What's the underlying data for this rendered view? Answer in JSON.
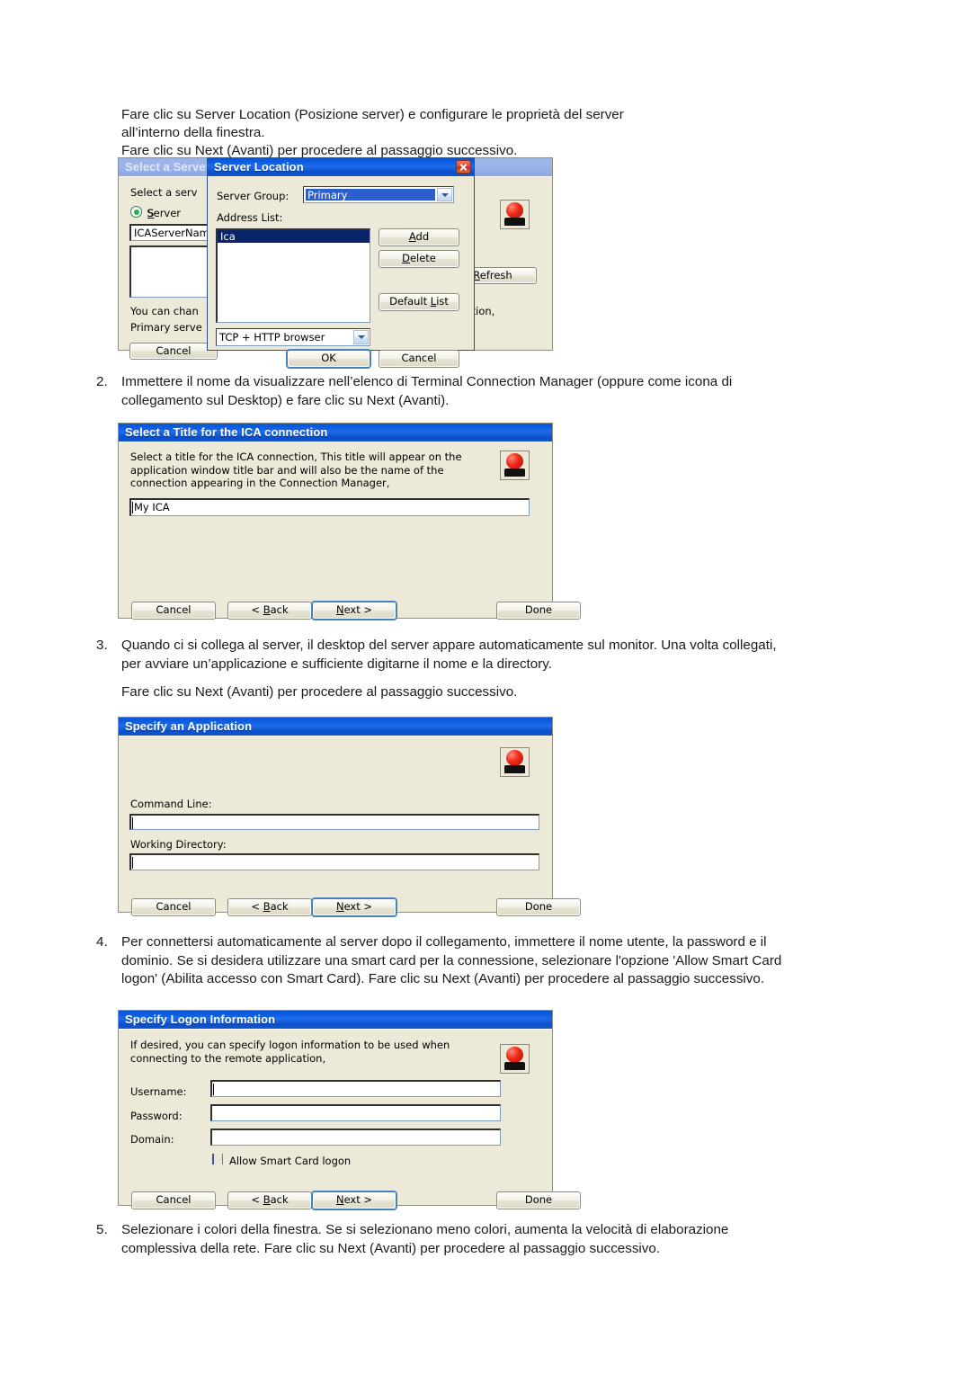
{
  "document": {
    "intro": {
      "line1": "Fare clic su Server Location (Posizione server) e configurare le proprietà del server",
      "line2": "all’interno della finestra.",
      "line3": "Fare clic su Next (Avanti) per procedere al passaggio successivo."
    },
    "steps": [
      {
        "number": "2.",
        "text": "Immettere il nome da visualizzare nell’elenco di Terminal Connection Manager (oppure come icona di collegamento sul Desktop) e fare clic su Next (Avanti)."
      },
      {
        "number": "3.",
        "text": "Quando ci si collega al server, il desktop del server appare automaticamente sul monitor. Una volta collegati, per avviare un’applicazione e sufficiente digitarne il nome e la directory.",
        "extra": "Fare clic su Next (Avanti) per procedere al passaggio successivo."
      },
      {
        "number": "4.",
        "text": "Per connettersi automaticamente al server dopo il collegamento, immettere il nome utente, la password e il dominio. Se si desidera utilizzare una smart card per la connessione, selezionare l'opzione 'Allow Smart Card logon' (Abilita accesso con Smart Card). Fare clic su Next (Avanti) per procedere al passaggio successivo."
      },
      {
        "number": "5.",
        "text": "Selezionare i colori della finestra. Se si selezionano meno colori, aumenta la velocità di elaborazione complessiva della rete. Fare clic su Next (Avanti) per procedere al passaggio successivo."
      }
    ]
  },
  "dialog_select_server": {
    "title": "Select a Server",
    "description": "Select a serv",
    "radio_server_label": "Server",
    "server_name_value": "ICAServerNam",
    "hint_line1": "You can chan",
    "hint_line2": "Primary serve",
    "hint_right": "Location,",
    "cancel_label": "Cancel",
    "refresh_label": "Refresh",
    "refresh_accel": "R",
    "icon": "citrix-app-icon"
  },
  "dialog_server_location": {
    "title": "Server Location",
    "close_icon": "close-icon",
    "server_group_label": "Server Group:",
    "server_group_value": "Primary",
    "address_list_label": "Address List:",
    "address_list_items": [
      "Ica"
    ],
    "protocol_value": "TCP + HTTP browser",
    "buttons": {
      "add": "Add",
      "add_accel": "A",
      "delete": "Delete",
      "delete_accel": "D",
      "default_list": "Default List",
      "default_list_accel": "L",
      "ok": "OK",
      "cancel": "Cancel"
    }
  },
  "dialog_select_title": {
    "title": "Select a Title for the ICA connection",
    "description": "Select a title for the ICA connection, This title will appear on the\napplication window title bar and will also be the name of the\nconnection appearing in the Connection Manager,",
    "title_value": "My ICA",
    "icon": "citrix-app-icon",
    "buttons": {
      "cancel": "Cancel",
      "back": "< Back",
      "back_accel": "B",
      "next": "Next >",
      "next_accel": "N",
      "done": "Done"
    }
  },
  "dialog_specify_application": {
    "title": "Specify an Application",
    "command_line_label": "Command Line:",
    "command_line_value": "",
    "working_directory_label": "Working Directory:",
    "working_directory_value": "",
    "icon": "citrix-app-icon",
    "buttons": {
      "cancel": "Cancel",
      "back": "< Back",
      "back_accel": "B",
      "next": "Next >",
      "next_accel": "N",
      "done": "Done"
    }
  },
  "dialog_specify_logon": {
    "title": "Specify Logon Information",
    "description": "If desired, you can specify logon information to be used when\nconnecting to the remote application,",
    "username_label": "Username:",
    "username_value": "",
    "password_label": "Password:",
    "password_value": "",
    "domain_label": "Domain:",
    "domain_value": "",
    "smartcard_label": "Allow Smart Card logon",
    "smartcard_checked": false,
    "icon": "citrix-app-icon",
    "buttons": {
      "cancel": "Cancel",
      "back": "< Back",
      "back_accel": "B",
      "next": "Next >",
      "next_accel": "N",
      "done": "Done"
    }
  },
  "colors": {
    "title_bar_active": "#0b5cdf",
    "title_bar_inactive": "#9db4e8",
    "dialog_face": "#ece9d8",
    "selection_blue": "#0a246a",
    "close_red": "#d63a16",
    "text": "#000000"
  }
}
